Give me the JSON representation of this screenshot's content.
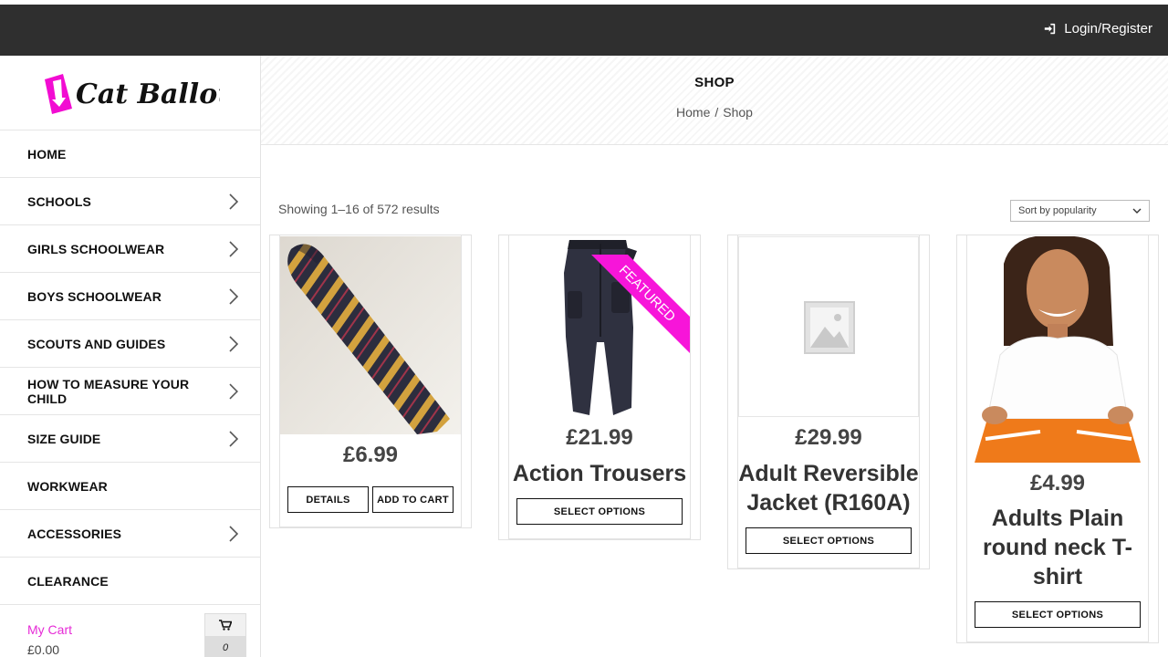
{
  "header": {
    "login_label": "Login/Register"
  },
  "logo": {
    "text": "I Cat Ballou"
  },
  "sidebar": {
    "items": [
      {
        "label": "HOME",
        "has_arrow": false
      },
      {
        "label": "SCHOOLS",
        "has_arrow": true
      },
      {
        "label": "GIRLS SCHOOLWEAR",
        "has_arrow": true
      },
      {
        "label": "BOYS SCHOOLWEAR",
        "has_arrow": true
      },
      {
        "label": "SCOUTS AND GUIDES",
        "has_arrow": true
      },
      {
        "label": "HOW TO MEASURE YOUR CHILD",
        "has_arrow": true
      },
      {
        "label": "SIZE GUIDE",
        "has_arrow": true
      },
      {
        "label": "WORKWEAR",
        "has_arrow": false
      },
      {
        "label": "ACCESSORIES",
        "has_arrow": true
      },
      {
        "label": "CLEARANCE",
        "has_arrow": false
      }
    ],
    "cart": {
      "title": "My Cart",
      "total": "£0.00",
      "count": "0"
    }
  },
  "page": {
    "title": "SHOP",
    "breadcrumb": {
      "home": "Home",
      "separator": "/",
      "current": "Shop"
    },
    "results_text": "Showing 1–16 of 572 results",
    "sort_selected": "Sort by popularity"
  },
  "products": [
    {
      "price": "£6.99",
      "name": "",
      "buttons": [
        "DETAILS",
        "ADD TO CART"
      ]
    },
    {
      "price": "£21.99",
      "name": "Action Trousers",
      "badge": "FEATURED",
      "buttons": [
        "SELECT OPTIONS"
      ]
    },
    {
      "price": "£29.99",
      "name_line1": "Adult Reversible",
      "name_line2": "Jacket (R160A)",
      "buttons": [
        "SELECT OPTIONS"
      ]
    },
    {
      "price": "£4.99",
      "name_line1": "Adults Plain",
      "name_line2": "round neck T-",
      "name_line3": "shirt",
      "buttons": [
        "SELECT OPTIONS"
      ]
    }
  ],
  "colors": {
    "accent": "#e62ad6",
    "topbar": "#2f2f2f",
    "ribbon": "#f715d9"
  }
}
